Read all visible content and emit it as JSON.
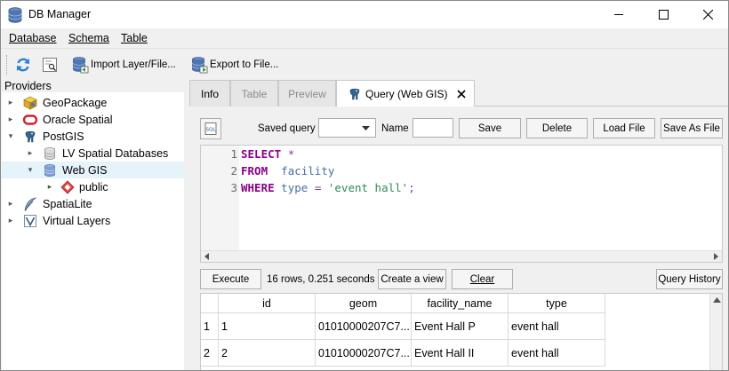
{
  "window": {
    "title": "DB Manager"
  },
  "menu": {
    "items": [
      "Database",
      "Schema",
      "Table"
    ]
  },
  "toolbar": {
    "refresh_icon": "refresh-icon",
    "info_icon": "sql-window-icon",
    "import_label": "Import Layer/File...",
    "export_label": "Export to File..."
  },
  "providers": {
    "title": "Providers",
    "items": [
      {
        "label": "GeoPackage",
        "icon": "geopackage-icon",
        "expanded": false
      },
      {
        "label": "Oracle Spatial",
        "icon": "oracle-icon",
        "expanded": false
      },
      {
        "label": "PostGIS",
        "icon": "postgis-elephant-icon",
        "expanded": true
      },
      {
        "label": "LV Spatial Databases",
        "icon": "database-icon",
        "expanded": false
      },
      {
        "label": "Web GIS",
        "icon": "database-icon",
        "expanded": true,
        "selected": true
      },
      {
        "label": "public",
        "icon": "schema-icon",
        "expanded": false
      },
      {
        "label": "SpatiaLite",
        "icon": "spatialite-feather-icon",
        "expanded": false
      },
      {
        "label": "Virtual Layers",
        "icon": "virtual-layer-icon",
        "expanded": false
      }
    ]
  },
  "tabs": [
    {
      "label": "Info",
      "state": "normal"
    },
    {
      "label": "Table",
      "state": "disabled"
    },
    {
      "label": "Preview",
      "state": "disabled"
    },
    {
      "label": "Query (Web GIS)",
      "state": "active"
    }
  ],
  "query": {
    "saved_query_label": "Saved query",
    "saved_query_value": "",
    "name_label": "Name",
    "name_value": "",
    "save_label": "Save",
    "delete_label": "Delete",
    "load_file_label": "Load File",
    "save_as_file_label": "Save As File",
    "line_numbers": [
      "1",
      "2",
      "3"
    ],
    "sql": {
      "select": "SELECT",
      "star": "*",
      "from": "FROM",
      "table": "facility",
      "where": "WHERE",
      "column": "type",
      "eq": "=",
      "literal": "'event hall'",
      "semicolon": ";"
    },
    "execute_label": "Execute",
    "status": "16 rows, 0.251 seconds",
    "create_view_label": "Create a view",
    "clear_label": "Clear",
    "history_label": "Query History"
  },
  "results": {
    "columns": [
      "id",
      "geom",
      "facility_name",
      "type"
    ],
    "rows": [
      {
        "num": "1",
        "id": "1",
        "geom": "01010000207C7...",
        "facility_name": "Event Hall P",
        "type": "event hall"
      },
      {
        "num": "2",
        "id": "2",
        "geom": "01010000207C7...",
        "facility_name": "Event Hall II",
        "type": "event hall"
      }
    ]
  }
}
